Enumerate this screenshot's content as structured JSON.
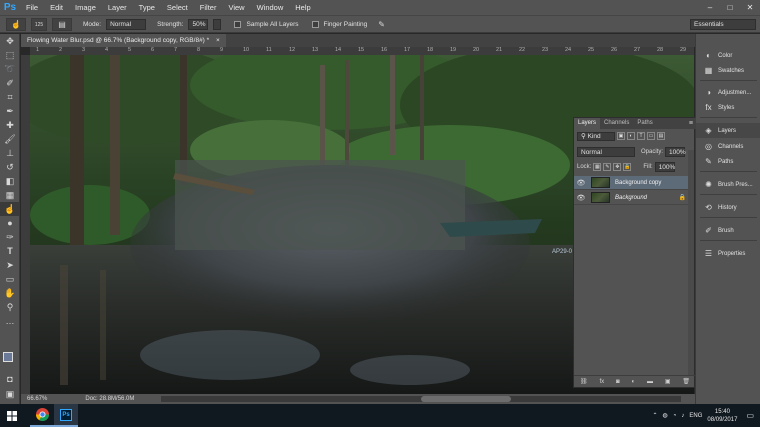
{
  "app": {
    "logo": "Ps"
  },
  "menubar": {
    "items": [
      "File",
      "Edit",
      "Image",
      "Layer",
      "Type",
      "Select",
      "Filter",
      "View",
      "Window",
      "Help"
    ]
  },
  "window_controls": {
    "minimize": "–",
    "maximize": "□",
    "close": "✕"
  },
  "options": {
    "mode_label": "Mode:",
    "mode_value": "Normal",
    "strength_label": "Strength:",
    "strength_value": "50%",
    "brush_size": "125",
    "sample_all_layers": "Sample All Layers",
    "finger_painting": "Finger Painting",
    "workspace": "Essentials"
  },
  "document": {
    "tab_title": "Flowing Water Blur.psd @ 66.7% (Background copy, RGB/8#) *",
    "tab_close": "×",
    "zoom": "66.67%",
    "doc_size": "Doc: 28.8M/56.0M",
    "ruler_marks": [
      "1",
      "2",
      "3",
      "4",
      "5",
      "6",
      "7",
      "8",
      "9",
      "10",
      "11",
      "12",
      "13",
      "14",
      "15",
      "16",
      "17",
      "18",
      "19",
      "20",
      "21",
      "22",
      "23",
      "24",
      "25",
      "26",
      "27",
      "28",
      "29"
    ]
  },
  "canvas_text": {
    "boat_label": "AP29-0"
  },
  "icon_strip": [
    {
      "label": "Color",
      "icon": "color-icon"
    },
    {
      "label": "Swatches",
      "icon": "swatches-icon"
    },
    {
      "label": "Adjustmen...",
      "icon": "adjustments-icon"
    },
    {
      "label": "Styles",
      "icon": "styles-icon"
    },
    {
      "label": "Layers",
      "icon": "layers-icon"
    },
    {
      "label": "Channels",
      "icon": "channels-icon"
    },
    {
      "label": "Paths",
      "icon": "paths-icon"
    },
    {
      "label": "Brush Pres...",
      "icon": "brush-presets-icon"
    },
    {
      "label": "History",
      "icon": "history-icon"
    },
    {
      "label": "Brush",
      "icon": "brush-icon"
    },
    {
      "label": "Properties",
      "icon": "properties-icon"
    }
  ],
  "layers_panel": {
    "tabs": [
      "Layers",
      "Channels",
      "Paths"
    ],
    "kind_label": "Kind",
    "blend_mode": "Normal",
    "opacity_label": "Opacity:",
    "opacity_value": "100%",
    "lock_label": "Lock:",
    "fill_label": "Fill:",
    "fill_value": "100%",
    "layers": [
      {
        "name": "Background copy",
        "selected": true
      },
      {
        "name": "Background",
        "selected": false
      }
    ],
    "footer_icons": [
      "link-icon",
      "fx-icon",
      "mask-icon",
      "adjustment-layer-icon",
      "group-icon",
      "new-layer-icon",
      "trash-icon"
    ]
  },
  "taskbar": {
    "language": "ENG",
    "time": "15:40",
    "date": "08/09/2017"
  }
}
